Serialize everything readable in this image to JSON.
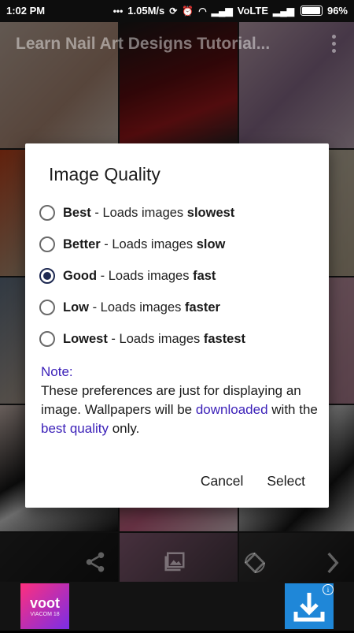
{
  "status": {
    "time": "1:02 PM",
    "speed": "1.05M/s",
    "network": "VoLTE",
    "battery": "96%"
  },
  "appbar": {
    "title": "Learn Nail Art Designs Tutorial..."
  },
  "dialog": {
    "title": "Image Quality",
    "options": [
      {
        "quality": "Best",
        "sep": " - ",
        "desc": "Loads images ",
        "speed": "slowest",
        "selected": false
      },
      {
        "quality": "Better",
        "sep": " - ",
        "desc": "Loads images ",
        "speed": "slow",
        "selected": false
      },
      {
        "quality": "Good",
        "sep": " - ",
        "desc": "Loads images ",
        "speed": "fast",
        "selected": true
      },
      {
        "quality": "Low",
        "sep": " - ",
        "desc": "Loads images ",
        "speed": "faster",
        "selected": false
      },
      {
        "quality": "Lowest",
        "sep": " - ",
        "desc": "Loads images ",
        "speed": "fastest",
        "selected": false
      }
    ],
    "note_label": "Note:",
    "note_text_1": "These preferences are just for displaying an image. Wallpapers will be ",
    "note_link_1": "downloaded",
    "note_text_2": " with the ",
    "note_link_2": "best quality",
    "note_text_3": " only.",
    "cancel_label": "Cancel",
    "select_label": "Select"
  },
  "ad": {
    "brand": "voot",
    "brand_sub": "VIACOM 18",
    "info": "i"
  },
  "colors": {
    "accent_link": "#3a1fb8",
    "radio_selected": "#1f2a52",
    "ad_download": "#1f87d8"
  },
  "icons": [
    "share-icon",
    "image-icon",
    "rotate-icon",
    "chevron-right-icon",
    "download-icon",
    "more-vert-icon"
  ]
}
